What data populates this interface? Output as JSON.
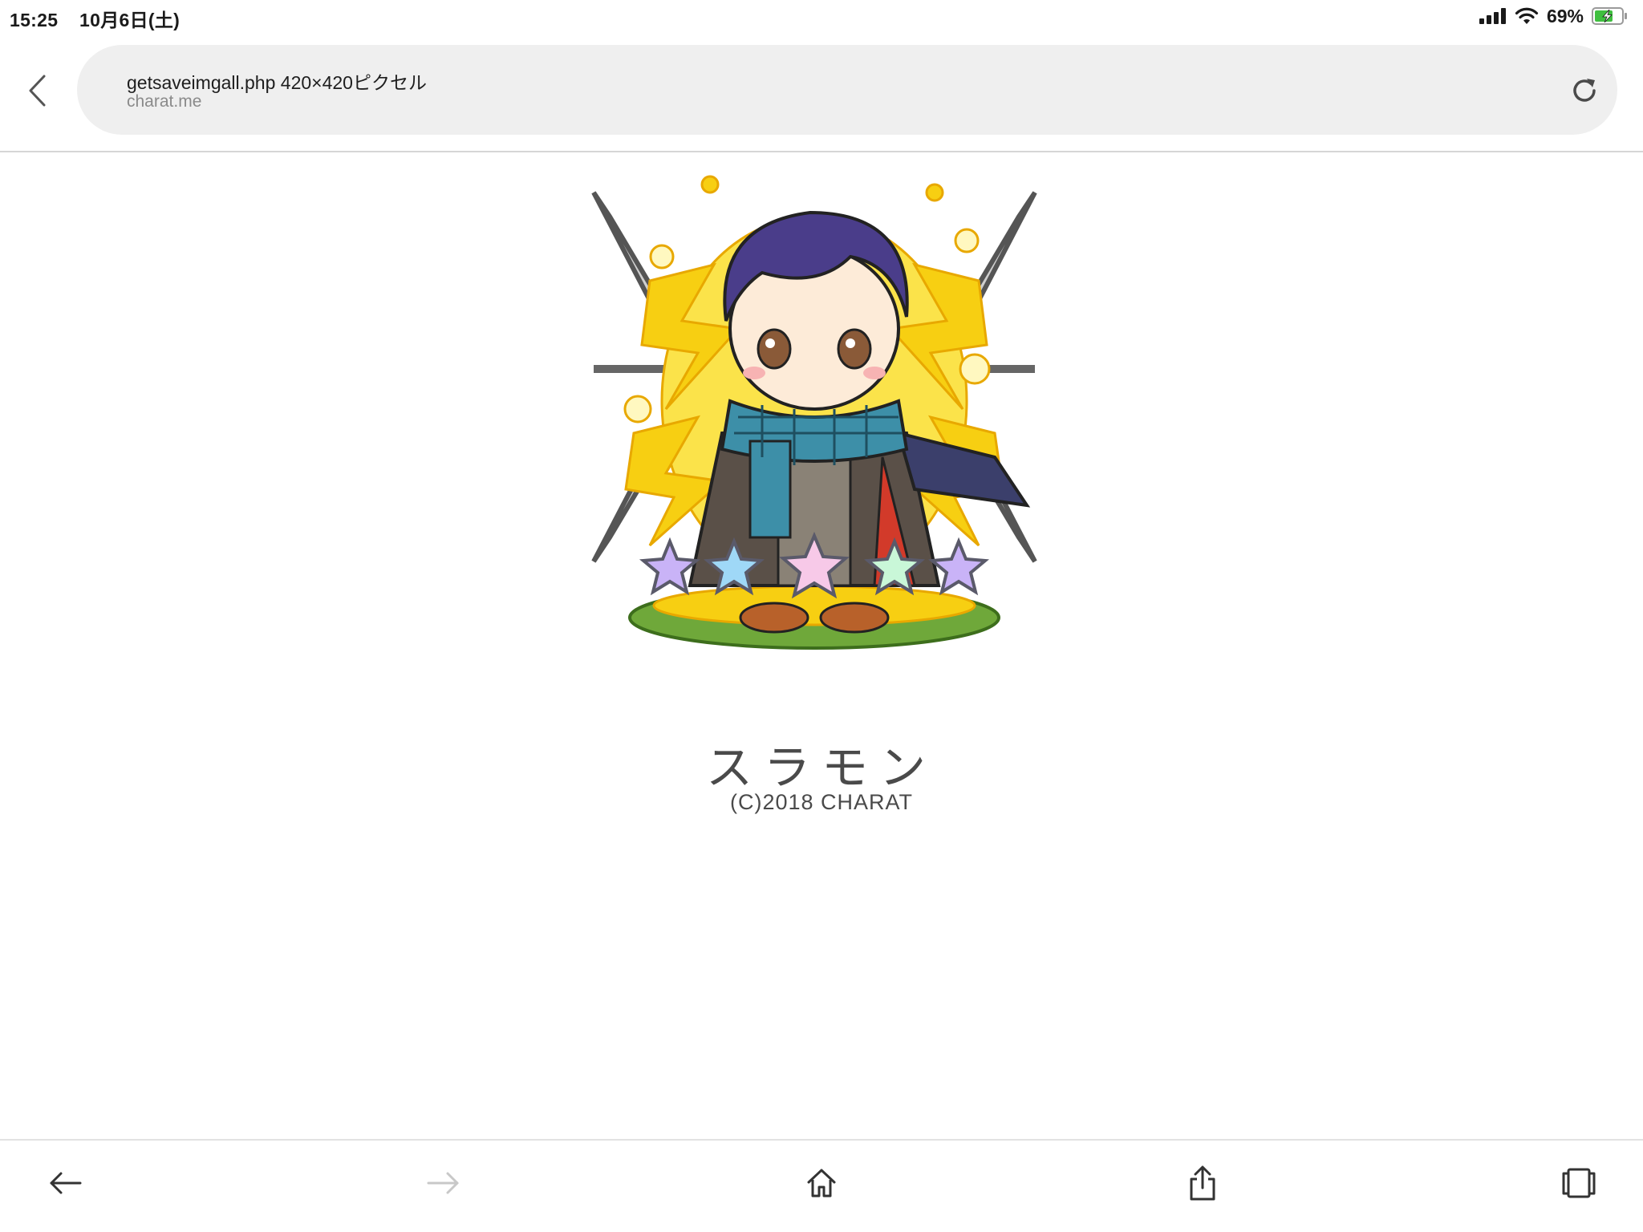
{
  "status_bar": {
    "time": "15:25",
    "date": "10月6日(土)",
    "battery_percent": "69%",
    "battery_level": 0.69,
    "charging": true
  },
  "address_bar": {
    "title": "getsaveimgall.php 420×420ピクセル",
    "host": "charat.me"
  },
  "image": {
    "name_text": "スラモン",
    "copyright_text": "(C)2018 CHARAT",
    "star_count": 5,
    "colors": {
      "lightning": "#f7cf12",
      "hair": "#4a3d8a",
      "scarf": "#3d8fa8",
      "grass": "#6fa83a"
    }
  },
  "toolbar": {
    "icons": [
      "back-arrow-icon",
      "forward-arrow-icon",
      "home-icon",
      "share-icon",
      "tabs-icon"
    ]
  }
}
